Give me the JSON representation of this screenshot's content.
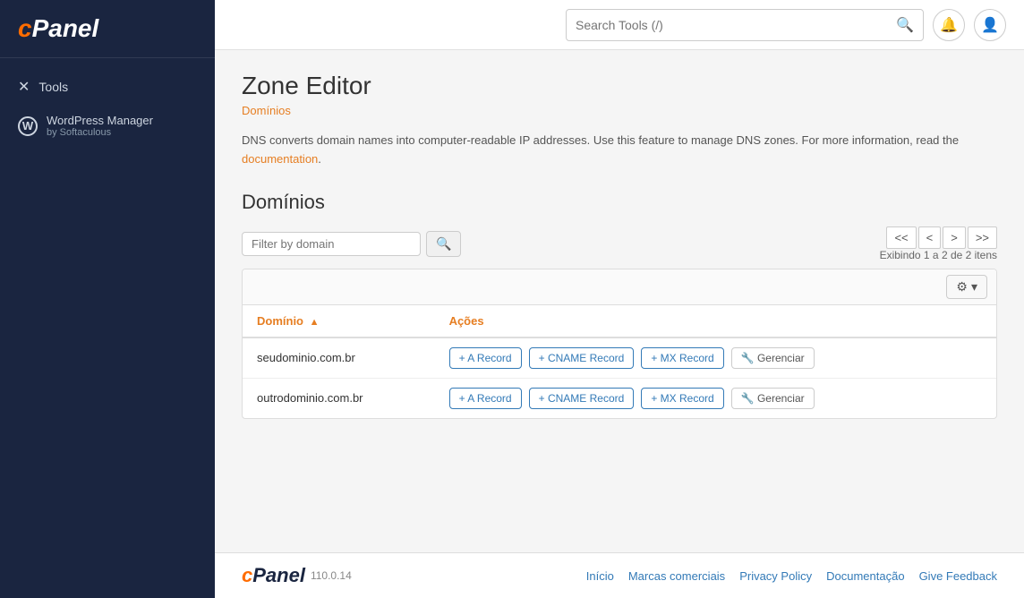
{
  "sidebar": {
    "logo_text": "cPanel",
    "items": [
      {
        "id": "tools",
        "label": "Tools",
        "icon": "✕"
      },
      {
        "id": "wordpress",
        "label": "WordPress Manager",
        "sublabel": "by Softaculous"
      }
    ]
  },
  "header": {
    "search_placeholder": "Search Tools (/)",
    "search_value": ""
  },
  "page": {
    "title": "Zone Editor",
    "breadcrumb": "Domínios",
    "description_static": "DNS converts domain names into computer-readable IP addresses. Use this feature to manage DNS zones. For more information, read the ",
    "description_link": "documentation",
    "description_end": ".",
    "section_title": "Domínios",
    "filter_placeholder": "Filter by domain",
    "pagination_info": "Exibindo 1 a 2 de 2 itens",
    "pagination": {
      "first": "<<",
      "prev": "<",
      "next": ">",
      "last": ">>"
    },
    "table": {
      "col_domain": "Domínio",
      "col_actions": "Ações",
      "rows": [
        {
          "domain": "seudominio.com.br",
          "btn_a": "+ A Record",
          "btn_cname": "+ CNAME Record",
          "btn_mx": "+ MX Record",
          "btn_manage": "🔧 Gerenciar"
        },
        {
          "domain": "outrodominio.com.br",
          "btn_a": "+ A Record",
          "btn_cname": "+ CNAME Record",
          "btn_mx": "+ MX Record",
          "btn_manage": "🔧 Gerenciar"
        }
      ]
    }
  },
  "footer": {
    "logo_text": "cPanel",
    "version": "110.0.14",
    "links": [
      {
        "id": "inicio",
        "label": "Início"
      },
      {
        "id": "marcas",
        "label": "Marcas comerciais"
      },
      {
        "id": "privacy",
        "label": "Privacy Policy"
      },
      {
        "id": "doc",
        "label": "Documentação"
      },
      {
        "id": "feedback",
        "label": "Give Feedback"
      }
    ]
  }
}
